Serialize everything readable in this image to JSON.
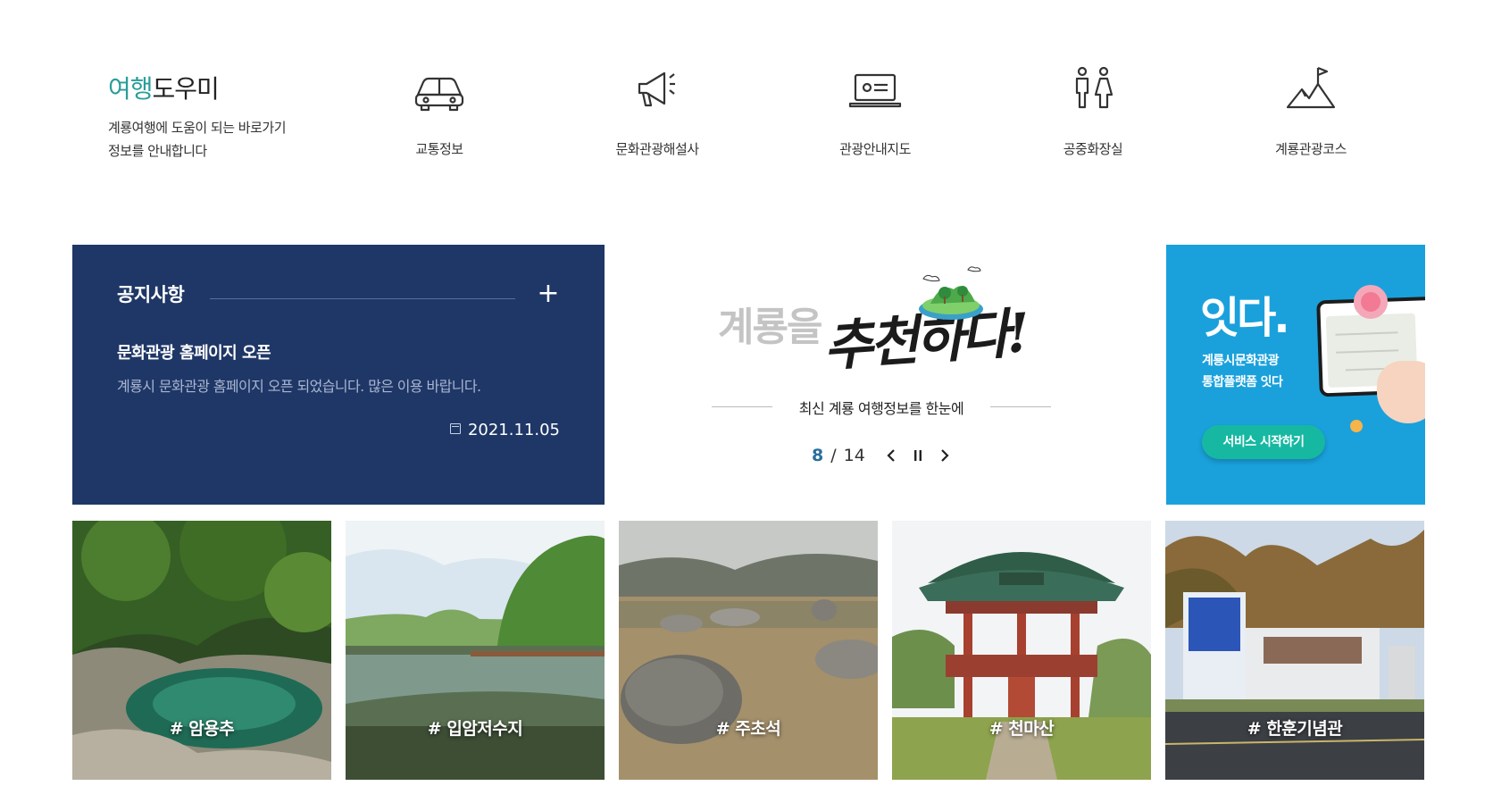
{
  "helper": {
    "title_accent": "여행",
    "title_rest": "도우미",
    "desc_line1": "계룡여행에 도움이 되는 바로가기",
    "desc_line2": "정보를 안내합니다",
    "links": [
      {
        "label": "교통정보",
        "icon": "car-icon"
      },
      {
        "label": "문화관광해설사",
        "icon": "megaphone-icon"
      },
      {
        "label": "관광안내지도",
        "icon": "map-laptop-icon"
      },
      {
        "label": "공중화장실",
        "icon": "restroom-icon"
      },
      {
        "label": "계룡관광코스",
        "icon": "mountain-flag-icon"
      }
    ]
  },
  "notice": {
    "title": "공지사항",
    "more_icon": "plus-icon",
    "subject": "문화관광 홈페이지 오픈",
    "body": "계룡시 문화관광 홈페이지 오픈 되었습니다. 많은 이용 바랍니다.",
    "date": "2021.11.05",
    "bg_color": "#1f3767"
  },
  "recommend": {
    "prefix": "계룡을",
    "headline": "추천하다!",
    "tagline": "최신 계룡 여행정보를 한눈에",
    "current": "8",
    "separator": "/",
    "total": "14",
    "prev_icon": "chevron-left-icon",
    "pause_icon": "pause-icon",
    "next_icon": "chevron-right-icon"
  },
  "platform": {
    "logo": "잇다.",
    "line1": "계룡시문화관광",
    "line2": "통합플랫폼 잇다",
    "button": "서비스 시작하기",
    "bg_color": "#1aa1dc",
    "button_color": "#17b8a2"
  },
  "places": [
    {
      "label": "# 암용추"
    },
    {
      "label": "# 입암저수지"
    },
    {
      "label": "# 주초석"
    },
    {
      "label": "# 천마산"
    },
    {
      "label": "# 한훈기념관"
    }
  ]
}
